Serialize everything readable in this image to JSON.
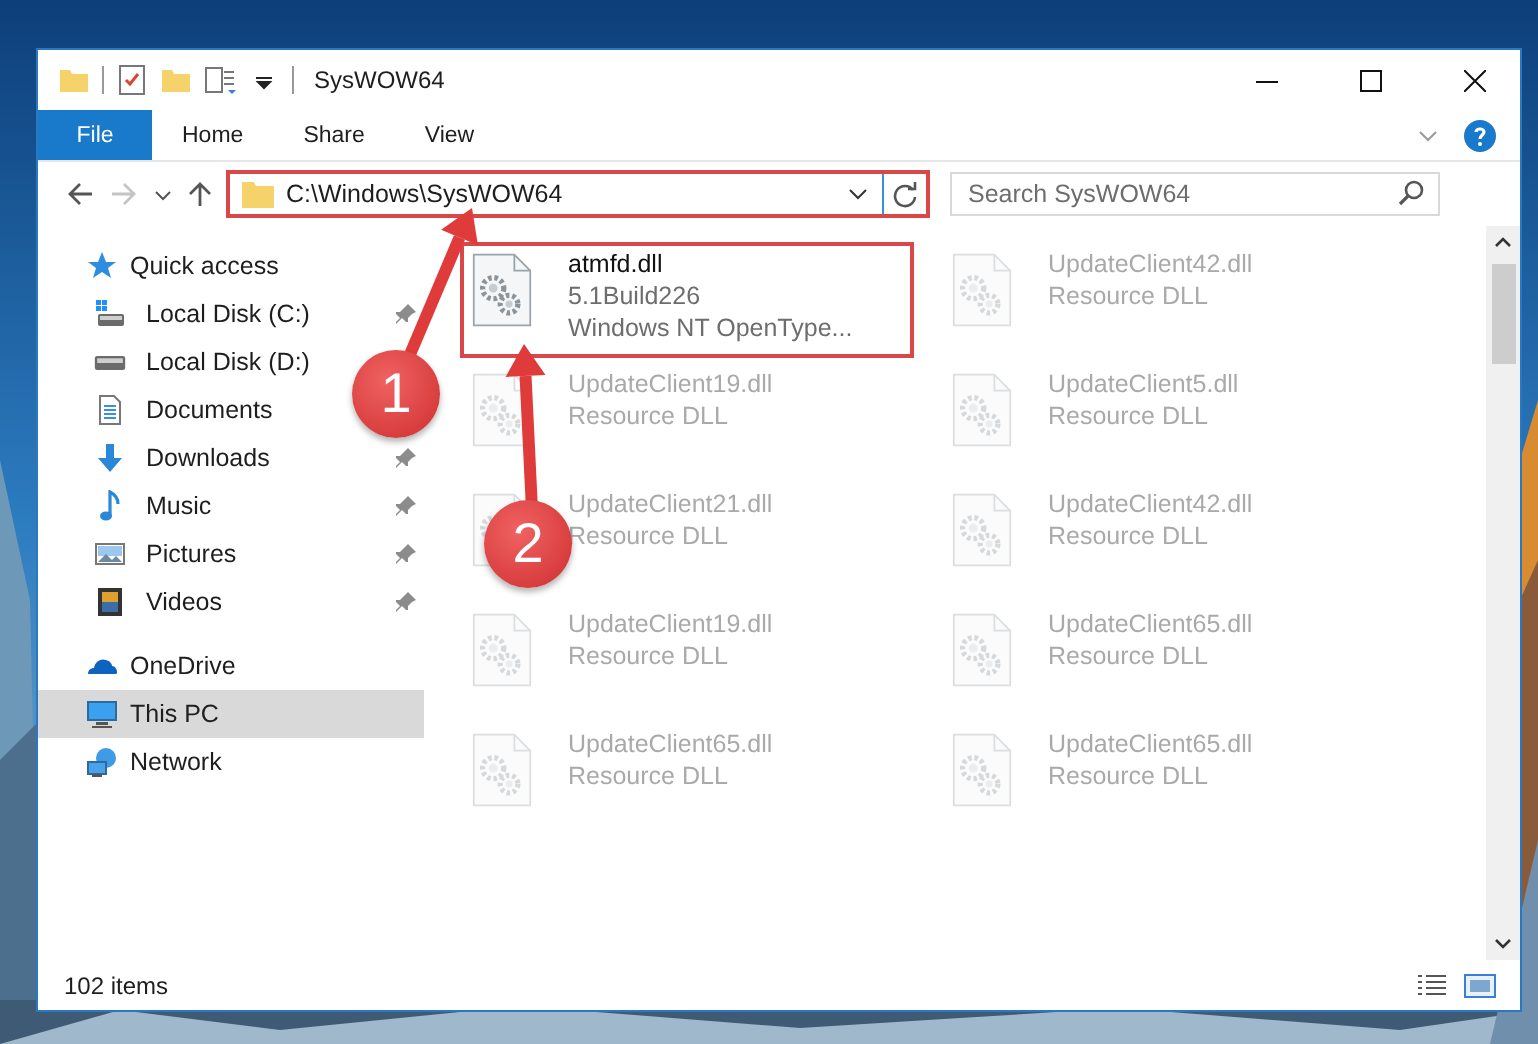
{
  "window": {
    "title": "SysWOW64"
  },
  "ribbon": {
    "tabs": [
      {
        "label": "File",
        "kind": "file"
      },
      {
        "label": "Home",
        "kind": "tab"
      },
      {
        "label": "Share",
        "kind": "tab"
      },
      {
        "label": "View",
        "kind": "tab"
      }
    ]
  },
  "address_bar": {
    "path": "C:\\Windows\\SysWOW64",
    "highlighted": true
  },
  "search": {
    "placeholder": "Search SysWOW64"
  },
  "navigation": {
    "items": [
      {
        "label": "Quick access",
        "kind": "star",
        "selected": false,
        "children": [
          {
            "label": "Local Disk (C:)",
            "kind": "system-drive",
            "pinned": true,
            "selected": false
          },
          {
            "label": "Local Disk (D:)",
            "kind": "drive",
            "selected": false
          },
          {
            "label": "Documents",
            "kind": "documents",
            "selected": false
          },
          {
            "label": "Downloads",
            "kind": "downloads",
            "pinned": true,
            "selected": false
          },
          {
            "label": "Music",
            "kind": "music",
            "pinned": true,
            "selected": false
          },
          {
            "label": "Pictures",
            "kind": "pictures",
            "pinned": true,
            "selected": false
          },
          {
            "label": "Videos",
            "kind": "videos",
            "pinned": true,
            "selected": false
          }
        ]
      },
      {
        "label": "OneDrive",
        "kind": "cloud",
        "selected": false
      },
      {
        "label": "This PC",
        "kind": "computer",
        "selected": true
      },
      {
        "label": "Network",
        "kind": "network",
        "selected": false
      }
    ]
  },
  "files": [
    {
      "name": "atmfd.dll",
      "details": [
        "5.1Build226",
        "Windows NT OpenType..."
      ],
      "highlighted": true,
      "dimmed": false
    },
    {
      "name": "UpdateClient42.dll",
      "details": [
        "Resource DLL"
      ],
      "highlighted": false,
      "dimmed": true
    },
    {
      "name": "UpdateClient19.dll",
      "details": [
        "Resource DLL"
      ],
      "highlighted": false,
      "dimmed": true
    },
    {
      "name": "UpdateClient5.dll",
      "details": [
        "Resource DLL"
      ],
      "highlighted": false,
      "dimmed": true
    },
    {
      "name": "UpdateClient21.dll",
      "details": [
        "Resource DLL"
      ],
      "highlighted": false,
      "dimmed": true
    },
    {
      "name": "UpdateClient42.dll",
      "details": [
        "Resource DLL"
      ],
      "highlighted": false,
      "dimmed": true
    },
    {
      "name": "UpdateClient19.dll",
      "details": [
        "Resource DLL"
      ],
      "highlighted": false,
      "dimmed": true
    },
    {
      "name": "UpdateClient65.dll",
      "details": [
        "Resource DLL"
      ],
      "highlighted": false,
      "dimmed": true
    },
    {
      "name": "UpdateClient65.dll",
      "details": [
        "Resource DLL"
      ],
      "highlighted": false,
      "dimmed": true
    },
    {
      "name": "UpdateClient65.dll",
      "details": [
        "Resource DLL"
      ],
      "highlighted": false,
      "dimmed": true
    }
  ],
  "status_bar": {
    "item_count": "102 items"
  },
  "annotations": [
    {
      "label": "1"
    },
    {
      "label": "2"
    }
  ]
}
